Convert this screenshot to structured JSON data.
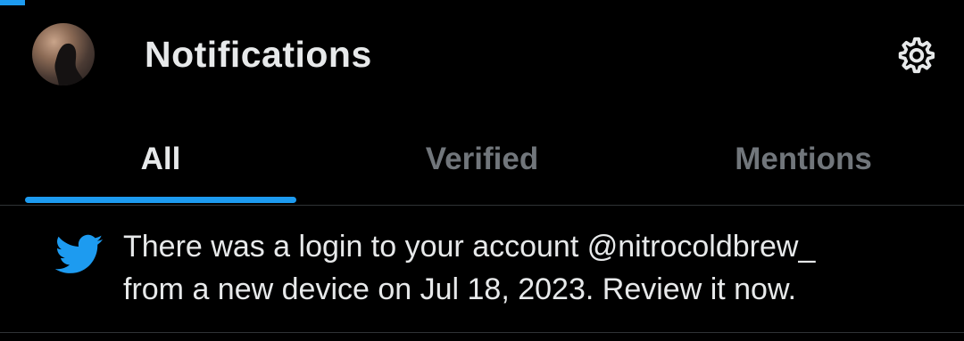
{
  "header": {
    "title": "Notifications",
    "avatar_icon": "user-avatar",
    "settings_icon": "gear-icon"
  },
  "tabs": [
    {
      "label": "All",
      "active": true
    },
    {
      "label": "Verified",
      "active": false
    },
    {
      "label": "Mentions",
      "active": false
    }
  ],
  "notifications": [
    {
      "icon": "twitter-bird-icon",
      "line1": "There was a login to your account @nitrocoldbrew_",
      "line2": "from a new device on Jul 18, 2023. Review it now."
    }
  ],
  "colors": {
    "background": "#000000",
    "accent": "#1d9bf0",
    "text_primary": "#e7e9ea",
    "text_secondary": "#71767b",
    "divider": "#2f3336"
  }
}
